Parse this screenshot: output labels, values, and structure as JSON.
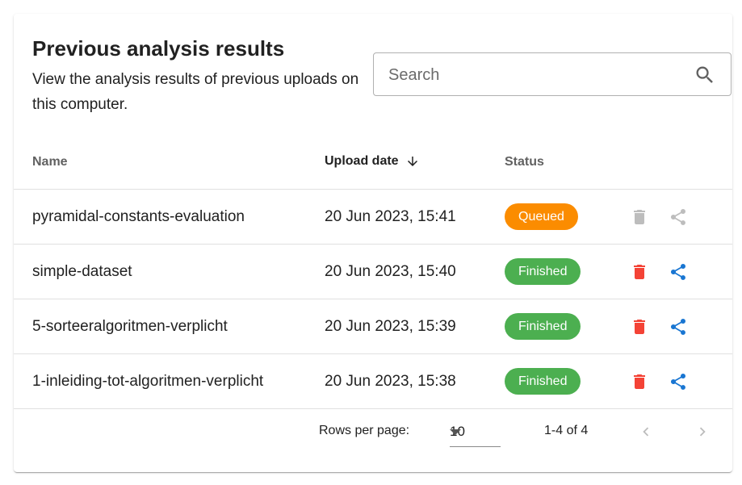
{
  "header": {
    "title": "Previous analysis results",
    "subtitle": "View the analysis results of previous uploads on this computer."
  },
  "search": {
    "placeholder": "Search",
    "value": "",
    "icon": "search-icon"
  },
  "table": {
    "columns": {
      "name": "Name",
      "upload_date": "Upload date",
      "status": "Status"
    },
    "sort": {
      "column": "upload_date",
      "direction": "descending"
    },
    "rows": [
      {
        "name": "pyramidal-constants-evaluation",
        "date": "20 Jun 2023, 15:41",
        "status": "Queued",
        "status_color": "#fb8c00",
        "actions_enabled": false
      },
      {
        "name": "simple-dataset",
        "date": "20 Jun 2023, 15:40",
        "status": "Finished",
        "status_color": "#4caf50",
        "actions_enabled": true
      },
      {
        "name": "5-sorteeralgoritmen-verplicht",
        "date": "20 Jun 2023, 15:39",
        "status": "Finished",
        "status_color": "#4caf50",
        "actions_enabled": true
      },
      {
        "name": "1-inleiding-tot-algoritmen-verplicht",
        "date": "20 Jun 2023, 15:38",
        "status": "Finished",
        "status_color": "#4caf50",
        "actions_enabled": true
      }
    ]
  },
  "pagination": {
    "rows_per_page_label": "Rows per page:",
    "rows_per_page": "10",
    "range": "1-4 of 4"
  },
  "colors": {
    "delete_active": "#f44336",
    "share_active": "#1976d2",
    "icon_disabled": "#bdbdbd"
  }
}
